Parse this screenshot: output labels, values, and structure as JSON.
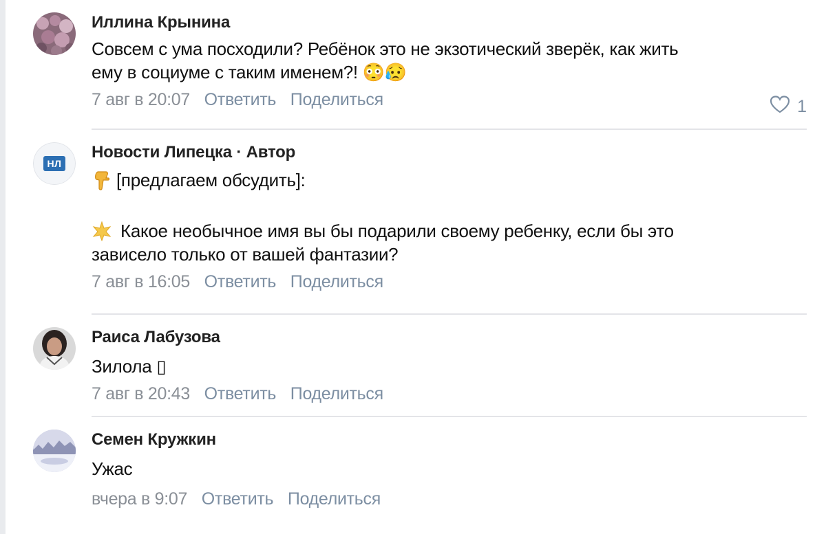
{
  "comments": [
    {
      "author": "Иллина Крынина",
      "text_lines": [
        "Совсем с ума посходили? Ребёнок это не экзотический зверёк, как жить",
        "ему в социуме с таким именем?! 😳😥"
      ],
      "date": "7 авг в 20:07",
      "reply_label": "Ответить",
      "share_label": "Поделиться",
      "likes": "1"
    },
    {
      "author": "Новости Липецка · Автор",
      "avatar_text": "НЛ",
      "text_lines": [
        "[предлагаем обсудить]:",
        "",
        "Какое необычное имя вы бы подарили своему ребенку, если бы это",
        "зависело только от вашей фантазии?"
      ],
      "date": "7 авг в 16:05",
      "reply_label": "Ответить",
      "share_label": "Поделиться"
    },
    {
      "author": "Раиса Лабузова",
      "text_lines": [
        "Зилола ▯"
      ],
      "date": "7 авг в 20:43",
      "reply_label": "Ответить",
      "share_label": "Поделиться"
    },
    {
      "author": "Семен Кружкин",
      "text_lines": [
        "Ужас"
      ],
      "date": "вчера в 9:07",
      "reply_label": "Ответить",
      "share_label": "Поделиться"
    }
  ],
  "icons": {
    "like": "heart-icon",
    "point_down": "point-down-emoji",
    "sparkle": "sparkle-emoji"
  },
  "colors": {
    "link": "#7c8ea2",
    "date": "#8a8f96",
    "logo_blue": "#2c6fb3"
  }
}
